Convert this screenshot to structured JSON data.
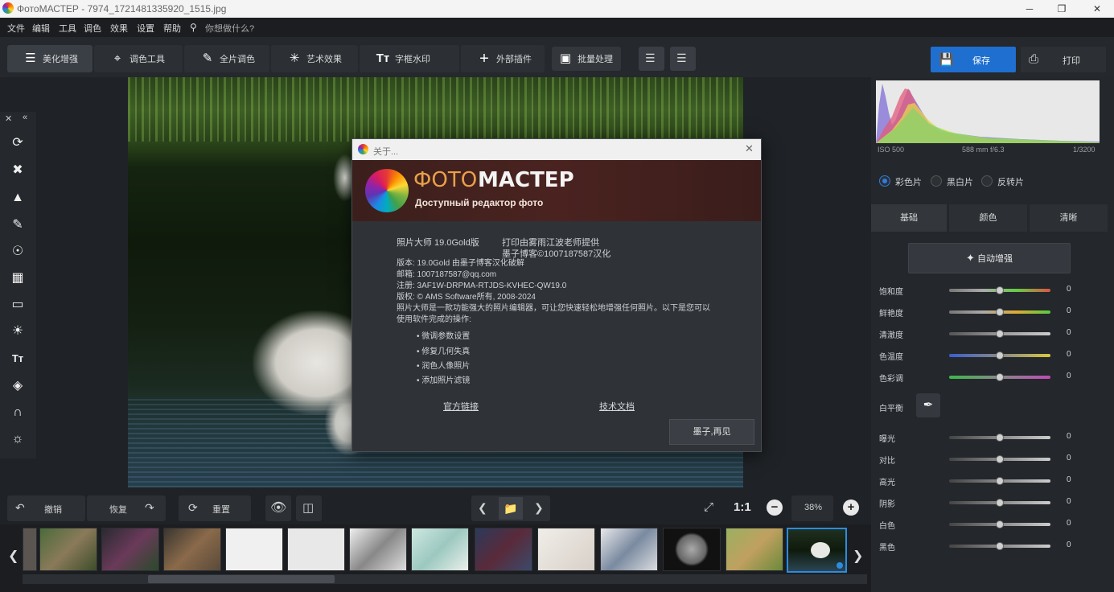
{
  "window": {
    "title": "ФотоМАСТЕР - 7974_1721481335920_1515.jpg",
    "min": "─",
    "restore": "❐",
    "close": "✕"
  },
  "menu": {
    "items": [
      "文件",
      "编辑",
      "工具",
      "调色",
      "效果",
      "设置",
      "帮助"
    ],
    "search_placeholder": "你想做什么?"
  },
  "toolbar": {
    "tabs": [
      {
        "label": "美化增强",
        "icon": "sliders-icon"
      },
      {
        "label": "调色工具",
        "icon": "crop-icon"
      },
      {
        "label": "全片调色",
        "icon": "brush-icon"
      },
      {
        "label": "艺术效果",
        "icon": "sparkle-icon"
      },
      {
        "label": "字框水印",
        "icon": "text-icon"
      },
      {
        "label": "外部插件",
        "icon": "plus-icon"
      }
    ],
    "batch_label": "批量处理",
    "save_label": "保存",
    "print_label": "打印"
  },
  "dialog": {
    "title": "关于...",
    "logo_text_light": "ФОТО",
    "logo_text_bold": "МАСТЕР",
    "logo_subtitle": "Доступный редактор фото",
    "product": "照片大师 19.0Gold版",
    "credit1": "打印由雾雨江波老师提供",
    "credit2": "墨子博客©1007187587汉化",
    "lines": [
      "版本: 19.0Gold 由墨子博客汉化破解",
      "邮箱: 1007187587@qq.com",
      "注册: 3AF1W-DRPMA-RTJDS-KVHEC-QW19.0",
      "版权: © AMS Software所有, 2008-2024",
      "照片大师是一款功能强大的照片编辑器，可让您快速轻松地增强任何照片。以下是您可以",
      "使用软件完成的操作:"
    ],
    "bullets": [
      "• 微调参数设置",
      "• 修复几何失真",
      "• 润色人像照片",
      "• 添加照片滤镜"
    ],
    "link_site": "官方链接",
    "link_docs": "技术文档",
    "ok_button": "墨子,再见"
  },
  "histogram": {
    "iso": "ISO 500",
    "focal": "588 mm f/6.3",
    "shutter": "1/3200"
  },
  "colormode": {
    "options": [
      "彩色片",
      "黑白片",
      "反转片"
    ],
    "selected": "彩色片"
  },
  "right_tabs": [
    "基础",
    "颜色",
    "清晰"
  ],
  "auto_button": "自动增强",
  "white_balance_label": "白平衡",
  "sliders_color": [
    {
      "label": "饱和度",
      "value": "0"
    },
    {
      "label": "鲜艳度",
      "value": "0"
    },
    {
      "label": "清澈度",
      "value": "0"
    },
    {
      "label": "色温度",
      "value": "0"
    },
    {
      "label": "色彩调",
      "value": "0"
    }
  ],
  "sliders_tone": [
    {
      "label": "曝光",
      "value": "0"
    },
    {
      "label": "对比",
      "value": "0"
    },
    {
      "label": "高光",
      "value": "0"
    },
    {
      "label": "阴影",
      "value": "0"
    },
    {
      "label": "白色",
      "value": "0"
    },
    {
      "label": "黑色",
      "value": "0"
    }
  ],
  "bottom": {
    "undo_label": "撤销",
    "redo_label": "恢复",
    "reset_label": "重置",
    "zoom_1to1": "1:1",
    "zoom_value": "38%"
  },
  "colors": {
    "accent": "#1e6fd0",
    "selection": "#2b8ce0"
  }
}
